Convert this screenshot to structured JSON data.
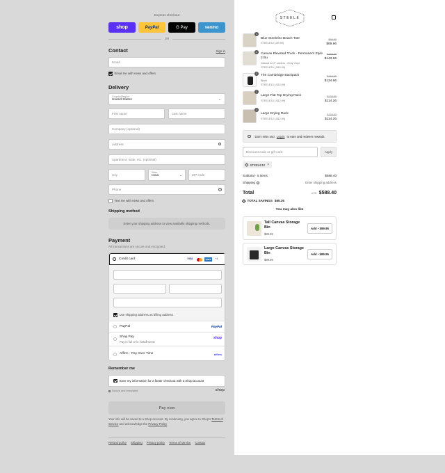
{
  "express": {
    "title": "Express checkout",
    "or": "OR",
    "buttons": [
      {
        "label": "shop",
        "color": "#5a31f4",
        "text_color": "#ffffff"
      },
      {
        "label": "PayPal",
        "color": "#ffc439",
        "text_color": "#003087"
      },
      {
        "label": "G Pay",
        "color": "#000000",
        "text_color": "#ffffff"
      },
      {
        "label": "venmo",
        "color": "#3d95ce",
        "text_color": "#ffffff"
      }
    ]
  },
  "contact": {
    "title": "Contact",
    "sign_in": "Sign in",
    "email_placeholder": "Email",
    "email_news": "Email me with news and offers",
    "email_news_checked": true
  },
  "delivery": {
    "title": "Delivery",
    "country_label": "Country/Region",
    "country_value": "United States",
    "first_name": "First name",
    "last_name": "Last name",
    "company": "Company (optional)",
    "address": "Address",
    "apartment": "Apartment, suite, etc. (optional)",
    "city": "City",
    "state_label": "State",
    "state_value": "Iowa",
    "zip": "ZIP code",
    "phone": "Phone",
    "text_news": "Text me with news and offers",
    "text_news_checked": false
  },
  "shipping_method": {
    "title": "Shipping method",
    "notice": "Enter your shipping address to view available shipping methods."
  },
  "payment": {
    "title": "Payment",
    "subtitle": "All transactions are secure and encrypted.",
    "credit_card": "Credit card",
    "card_brands": [
      "VISA",
      "MC",
      "AMEX",
      "+4"
    ],
    "billing_same": "Use shipping address as billing address",
    "billing_same_checked": true,
    "paypal": "PayPal",
    "paypal_logo": "PayPal",
    "shop_pay": "Shop Pay",
    "shop_pay_sub": "Pay in full or in installments",
    "shop_pay_logo": "shop",
    "affirm": "Affirm - Pay Over Time",
    "affirm_logo": "affirm"
  },
  "remember": {
    "title": "Remember me",
    "save_info": "Save my information for a faster checkout with a Shop account",
    "save_checked": true,
    "secure": "Secure and encrypted",
    "shop_logo": "shop"
  },
  "pay_now": "Pay now",
  "legal": {
    "text": "Your info will be saved to a Shop account. By continuing, you agree to Shop's",
    "terms": "Terms of Service",
    "and": "and acknowledge the",
    "privacy": "Privacy Policy"
  },
  "footer_links": [
    "Refund policy",
    "Shipping",
    "Privacy policy",
    "Terms of service",
    "Contact"
  ],
  "store": {
    "logo": "STEELE"
  },
  "cart": {
    "items": [
      {
        "qty": "1",
        "name": "Blue Steelelex Beach Tote",
        "variant": "",
        "promo": "STEELE10 (-$9.99)",
        "old": "$99.95",
        "new": "$89.96"
      },
      {
        "qty": "1",
        "name": "Canvas Elevated Truck - Permanent Style 2 Bu",
        "variant": "Natural w/ 2\" casters - Gray Vinyl",
        "promo": "STEELE10 (-$15.99)",
        "old": "$159.95",
        "new": "$143.96"
      },
      {
        "qty": "1",
        "name": "The Cambridge Backpack",
        "variant": "Black",
        "promo": "STEELE10 (-$14.99)",
        "old": "$149.95",
        "new": "$134.96"
      },
      {
        "qty": "1",
        "name": "Large Flat Top Drying Rack",
        "variant": "",
        "promo": "STEELE10 (-$12.99)",
        "old": "$129.95",
        "new": "$114.26"
      },
      {
        "qty": "1",
        "name": "Large Drying Rack",
        "variant": "",
        "promo": "STEELE10 (-$12.99)",
        "old": "$129.95",
        "new": "$114.26"
      }
    ],
    "rewards": "Don't miss out!",
    "rewards_link": "Log in",
    "rewards_rest": "to earn and redeem rewards",
    "discount_placeholder": "Discount code or gift card",
    "apply": "Apply",
    "applied_code": "STEELE10",
    "subtotal_label": "Subtotal · 5 items",
    "subtotal_value": "$588.40",
    "shipping_label": "Shipping",
    "shipping_value": "Enter shipping address",
    "total_label": "Total",
    "currency": "USD",
    "total_value": "$588.40",
    "savings_label": "TOTAL SAVINGS",
    "savings_value": "$65.35"
  },
  "upsell": {
    "title": "You may also like",
    "items": [
      {
        "name": "Tall Canvas Storage Bin",
        "price": "$89.95",
        "button": "Add • $89.95"
      },
      {
        "name": "Large Canvas Storage Bin",
        "price": "$89.95",
        "button": "Add • $89.95"
      }
    ]
  }
}
